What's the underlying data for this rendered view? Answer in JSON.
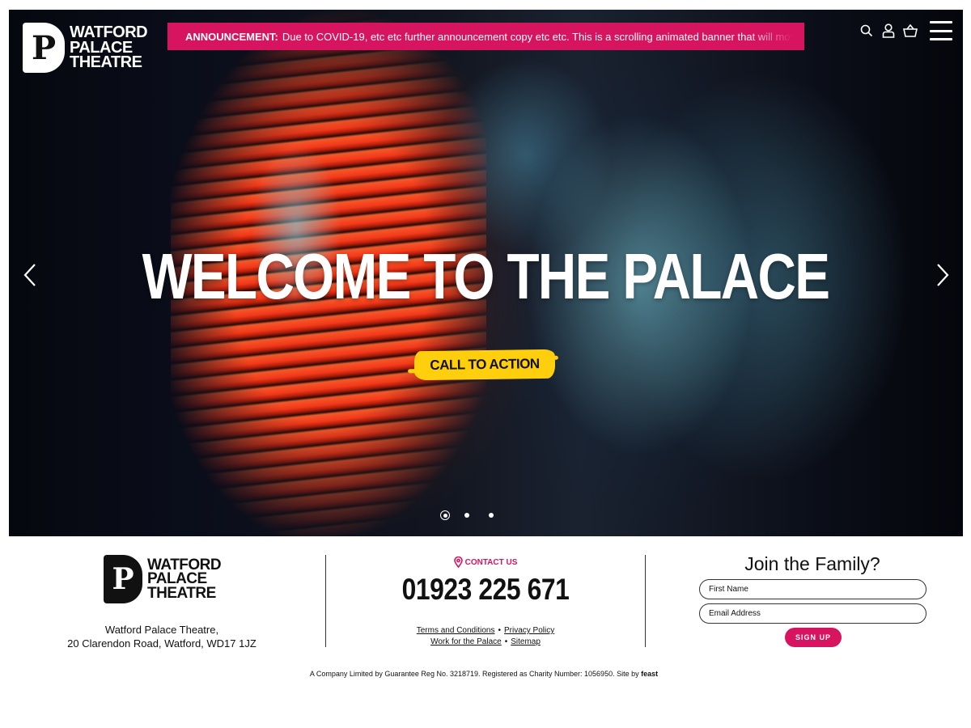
{
  "brand": {
    "name_lines": [
      "Watford",
      "Palace",
      "Theatre"
    ],
    "logo_mark": "P"
  },
  "announcement": {
    "label": "ANNOUNCEMENT:",
    "text": "Due to COVID-19, etc etc further announcement copy etc etc. This is a scrolling animated banner that will move"
  },
  "header_icons": [
    "search-icon",
    "account-icon",
    "basket-icon",
    "menu-icon"
  ],
  "hero": {
    "title": "WELCOME TO THE PALACE",
    "cta_label": "CALL TO ACTION",
    "slides_count": 3,
    "active_slide": 1
  },
  "footer": {
    "address_lines": [
      "Watford Palace Theatre,",
      "20 Clarendon Road, Watford, WD17 1JZ"
    ],
    "contact_label": "CONTACT US",
    "phone": "01923 225 671",
    "links": {
      "terms": "Terms and Conditions",
      "privacy": "Privacy Policy",
      "work": "Work for the Palace",
      "sitemap": "Sitemap"
    },
    "join": {
      "title": "Join the Family?",
      "first_name_placeholder": "First Name",
      "email_placeholder": "Email Address",
      "signup_label": "SIGN UP"
    },
    "legal_text": "A Company Limited by Guarantee Reg No. 3218719. Registered as Charity Number: 1056950. Site by",
    "legal_credit": "feast"
  },
  "colors": {
    "accent_pink": "#d6145f",
    "cta_yellow": "#ffcf0d",
    "hero_bg": "#0a0d1a"
  }
}
